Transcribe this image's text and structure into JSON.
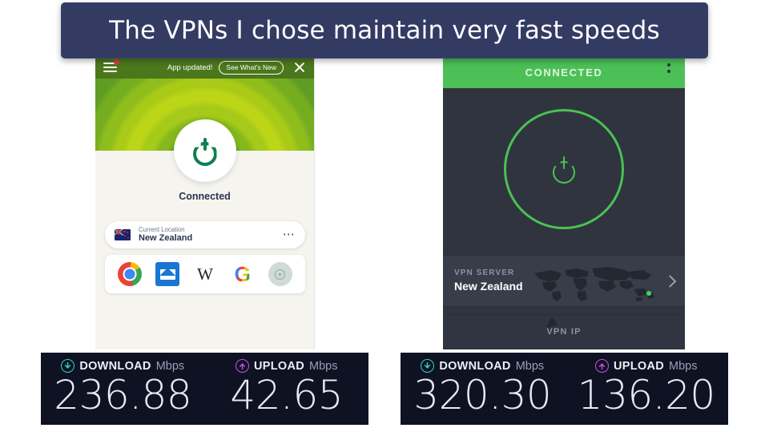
{
  "banner": {
    "text": "The VPNs I chose maintain very fast speeds",
    "background": "#333b63",
    "text_color": "#ffffff"
  },
  "left_app": {
    "topbar": {
      "menu_icon": "hamburger-menu-icon",
      "badge_dot_color": "#e03b3b",
      "updated_text": "App updated!",
      "whats_new_label": "See What's New",
      "close_icon": "close-icon"
    },
    "power_button": {
      "icon": "power-icon",
      "icon_color": "#0d8050"
    },
    "status_text": "Connected",
    "location": {
      "flag_icon": "new-zealand-flag-icon",
      "label": "Current Location",
      "value": "New Zealand",
      "overflow_icon": "more-options-icon"
    },
    "shortcuts": [
      {
        "name": "chrome-icon",
        "label": "Chrome"
      },
      {
        "name": "mail-icon",
        "label": "Mail"
      },
      {
        "name": "wikipedia-icon",
        "label": "W"
      },
      {
        "name": "google-icon",
        "label": "G"
      },
      {
        "name": "add-shortcut-icon",
        "label": "+"
      }
    ]
  },
  "right_app": {
    "header": {
      "title": "CONNECTED",
      "background": "#4cc057",
      "kebab_icon": "more-options-vertical-icon"
    },
    "power_button": {
      "icon": "power-icon",
      "ring_color": "#49c254"
    },
    "server_row": {
      "label": "VPN SERVER",
      "value": "New Zealand",
      "map_icon": "world-map-icon",
      "location_dot_color": "#3ddc4f",
      "chevron_icon": "chevron-right-icon"
    },
    "ip_row": {
      "label": "VPN IP"
    },
    "cursor_icon": "mouse-pointer-icon"
  },
  "speed_tests": [
    {
      "id": "speed-test-left",
      "download": {
        "icon": "download-arrow-icon",
        "label": "DOWNLOAD",
        "unit": "Mbps",
        "value": "236.88",
        "color": "#2fd4c4"
      },
      "upload": {
        "icon": "upload-arrow-icon",
        "label": "UPLOAD",
        "unit": "Mbps",
        "value": "42.65",
        "color": "#c850e0"
      }
    },
    {
      "id": "speed-test-right",
      "download": {
        "icon": "download-arrow-icon",
        "label": "DOWNLOAD",
        "unit": "Mbps",
        "value": "320.30",
        "color": "#2fd4c4"
      },
      "upload": {
        "icon": "upload-arrow-icon",
        "label": "UPLOAD",
        "unit": "Mbps",
        "value": "136.20",
        "color": "#c850e0"
      }
    }
  ]
}
